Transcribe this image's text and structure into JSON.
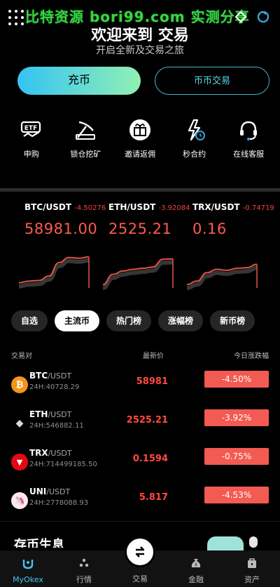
{
  "watermark": "比特资源 bori99.com 实测分享",
  "hero": {
    "title": "欢迎来到 交易",
    "subtitle": "开启全新及交易之旅"
  },
  "actions": {
    "deposit": "充币",
    "spot_trade": "币币交易"
  },
  "quick_menu": [
    {
      "label": "申购",
      "icon": "etf-icon"
    },
    {
      "label": "锁仓挖矿",
      "icon": "pickaxe-icon"
    },
    {
      "label": "邀请返佣",
      "icon": "gift-icon"
    },
    {
      "label": "秒合约",
      "icon": "lightning-clock-icon"
    },
    {
      "label": "在线客服",
      "icon": "headset-icon"
    }
  ],
  "tickers": [
    {
      "pair": "BTC/USDT",
      "change": "-4.50276",
      "price": "58981.00",
      "spark": [
        0.15,
        0.2,
        0.22,
        0.35,
        0.75,
        0.9,
        0.88,
        0.92
      ]
    },
    {
      "pair": "ETH/USDT",
      "change": "-3.92084",
      "price": "2525.21",
      "spark": [
        0.1,
        0.4,
        0.5,
        0.55,
        0.58,
        0.62,
        0.85,
        0.86
      ]
    },
    {
      "pair": "TRX/USDT",
      "change": "-0.74719",
      "price": "0.16",
      "spark": [
        0.1,
        0.2,
        0.45,
        0.55,
        0.52,
        0.58,
        0.6,
        0.7
      ]
    }
  ],
  "tabs": [
    "自选",
    "主流币",
    "热门榜",
    "涨幅榜",
    "新币榜"
  ],
  "active_tab": 1,
  "list_header": {
    "pair": "交易对",
    "last_price": "最新价",
    "change": "今日涨跌幅"
  },
  "market": [
    {
      "base": "BTC",
      "quote": "/USDT",
      "volume": "24H:40728.29",
      "price": "58981",
      "change": "-4.50%",
      "logo_color": "#f7931a",
      "logo_glyph": "₿"
    },
    {
      "base": "ETH",
      "quote": "/USDT",
      "volume": "24H:546882.11",
      "price": "2525.21",
      "change": "-3.92%",
      "logo_color": "#000000",
      "logo_glyph": "◆"
    },
    {
      "base": "TRX",
      "quote": "/USDT",
      "volume": "24H:714499185.50",
      "price": "0.1594",
      "change": "-0.75%",
      "logo_color": "#e50914",
      "logo_glyph": "▼"
    },
    {
      "base": "UNI",
      "quote": "/USDT",
      "volume": "24H:2778088.93",
      "price": "5.817",
      "change": "-4.53%",
      "logo_color": "#fde8f1",
      "logo_glyph": "🦄"
    }
  ],
  "news_title": "存币生息",
  "bottom_nav": [
    {
      "label": "MyOkex",
      "icon": "home-logo-icon"
    },
    {
      "label": "行情",
      "icon": "market-icon"
    },
    {
      "label": "交易",
      "icon": "swap-icon"
    },
    {
      "label": "金融",
      "icon": "money-bag-icon"
    },
    {
      "label": "资产",
      "icon": "wallet-icon"
    }
  ],
  "colors": {
    "accent": "#4cc3ef",
    "down": "#f25a52",
    "watermark": "#3cd43c"
  }
}
